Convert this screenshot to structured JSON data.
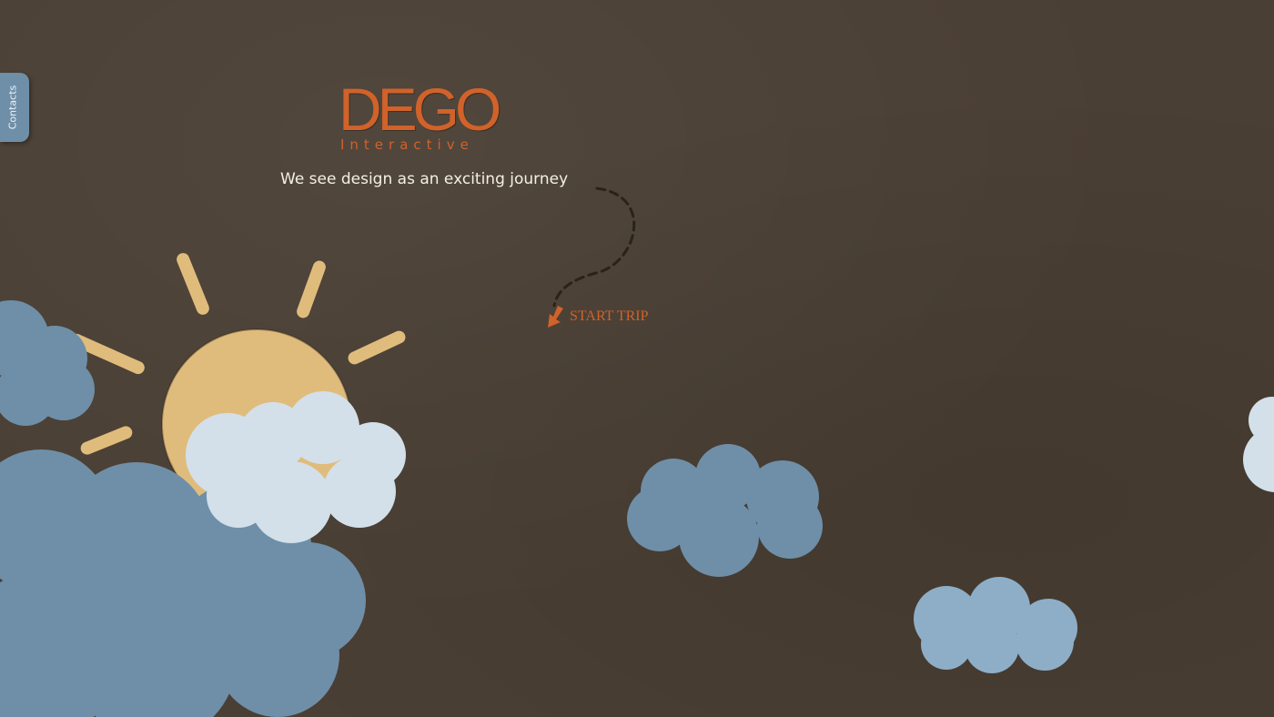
{
  "contacts_tab": {
    "label": "Contacts"
  },
  "logo": {
    "main": "DEGO",
    "sub": "Interactive"
  },
  "tagline": "We see design as an exciting journey",
  "start_trip": {
    "label": "START TRIP",
    "icon": "arrow-down-left-icon"
  },
  "colors": {
    "background": "#4a3f34",
    "accent": "#d0622a",
    "sun": "#e0bc7c",
    "cloud_dark": "#6f8fa8",
    "cloud_light": "#d3e0ea",
    "cloud_mid": "#8eaec7"
  }
}
